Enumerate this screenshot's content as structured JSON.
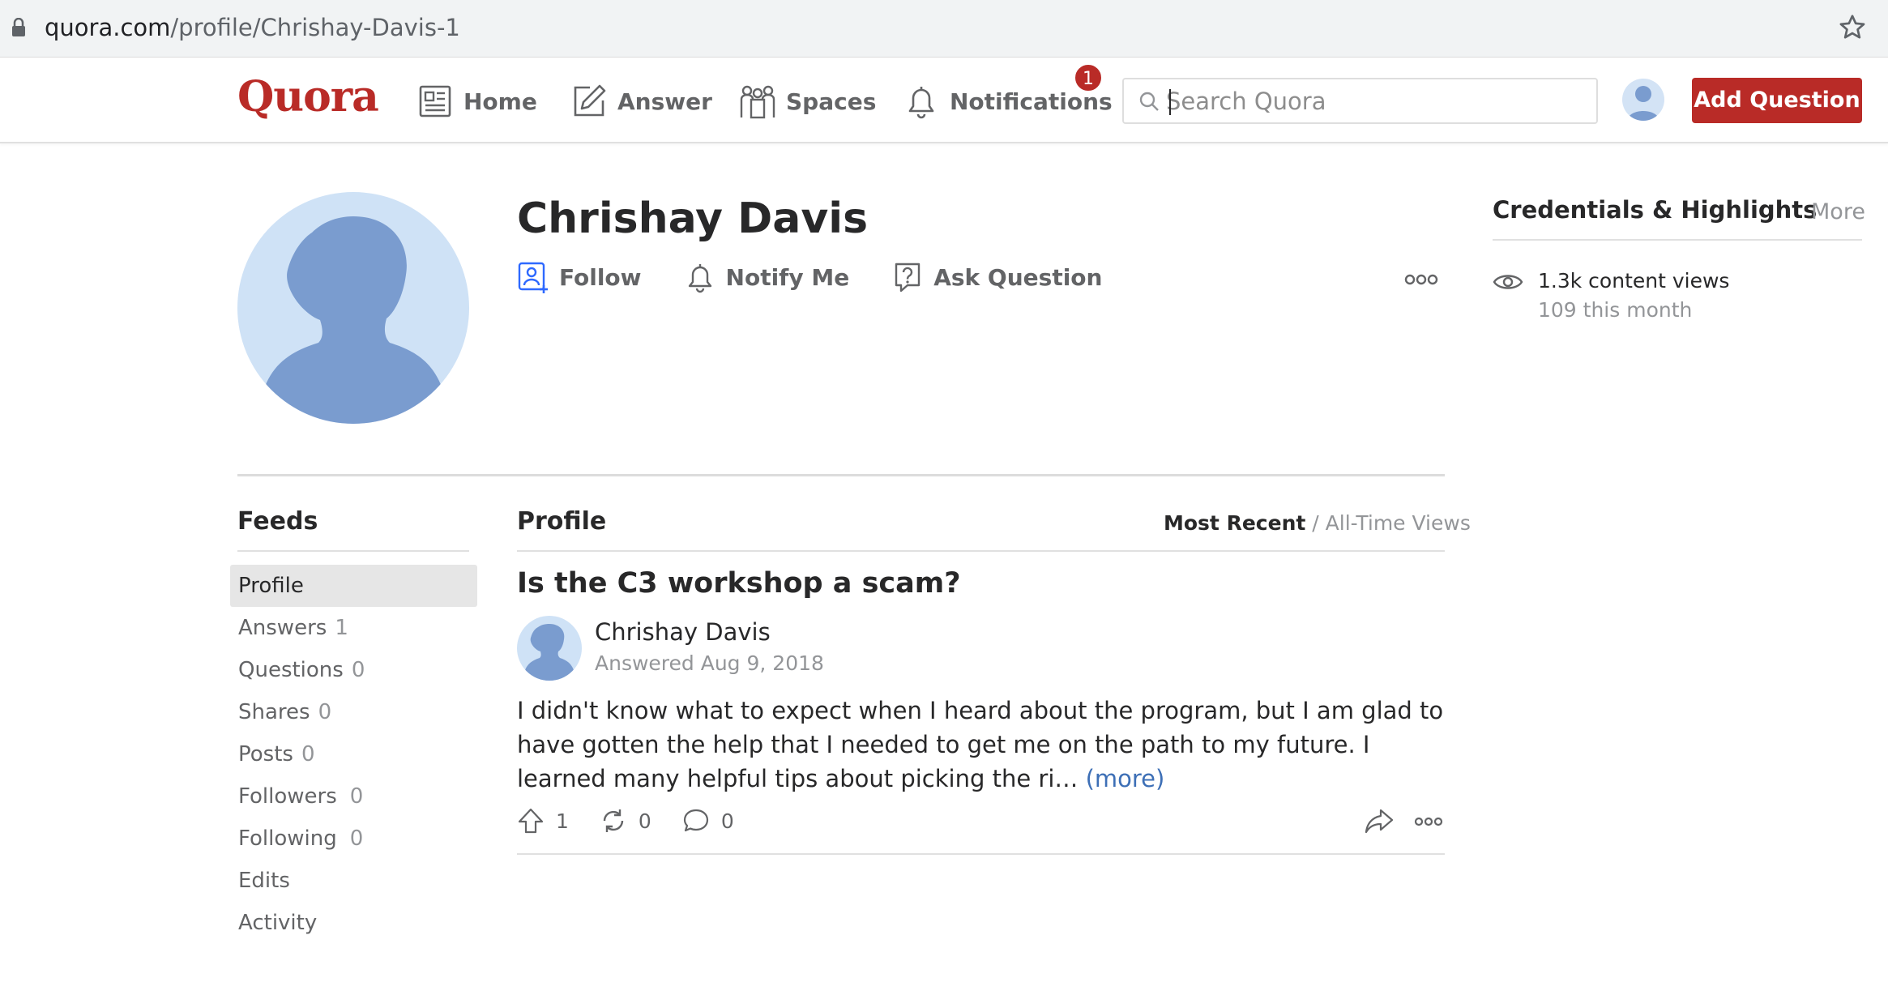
{
  "browser": {
    "url_domain": "quora.com",
    "url_path": "/profile/Chrishay-Davis-1"
  },
  "header": {
    "logo": "Quora",
    "nav": {
      "home": "Home",
      "answer": "Answer",
      "spaces": "Spaces",
      "notifications": "Notifications",
      "notification_count": "1"
    },
    "search_placeholder": "Search Quora",
    "add_question": "Add Question"
  },
  "profile": {
    "name": "Chrishay Davis",
    "actions": {
      "follow": "Follow",
      "notify": "Notify Me",
      "ask": "Ask Question"
    }
  },
  "credentials": {
    "title": "Credentials & Highlights",
    "more": "More",
    "views": "1.3k content views",
    "views_month": "109 this month"
  },
  "feeds": {
    "title": "Feeds",
    "items": [
      {
        "label": "Profile",
        "count": ""
      },
      {
        "label": "Answers",
        "count": "1"
      },
      {
        "label": "Questions",
        "count": "0"
      },
      {
        "label": "Shares",
        "count": "0"
      },
      {
        "label": "Posts",
        "count": "0"
      },
      {
        "label": "Followers",
        "count": "0"
      },
      {
        "label": "Following",
        "count": "0"
      },
      {
        "label": "Edits",
        "count": ""
      },
      {
        "label": "Activity",
        "count": ""
      }
    ]
  },
  "main": {
    "title": "Profile",
    "sort_recent": "Most Recent",
    "sort_sep": " / ",
    "sort_views": "All-Time Views",
    "question": "Is the C3 workshop a scam?",
    "author": "Chrishay Davis",
    "answered": "Answered Aug 9, 2018",
    "body": "I didn't know what to expect when I heard about the program, but I am glad to have gotten the help that I needed to get me on the path to my future. I learned many helpful tips about picking the ri… ",
    "more_link": "(more)",
    "upvotes": "1",
    "shares": "0",
    "comments": "0"
  }
}
